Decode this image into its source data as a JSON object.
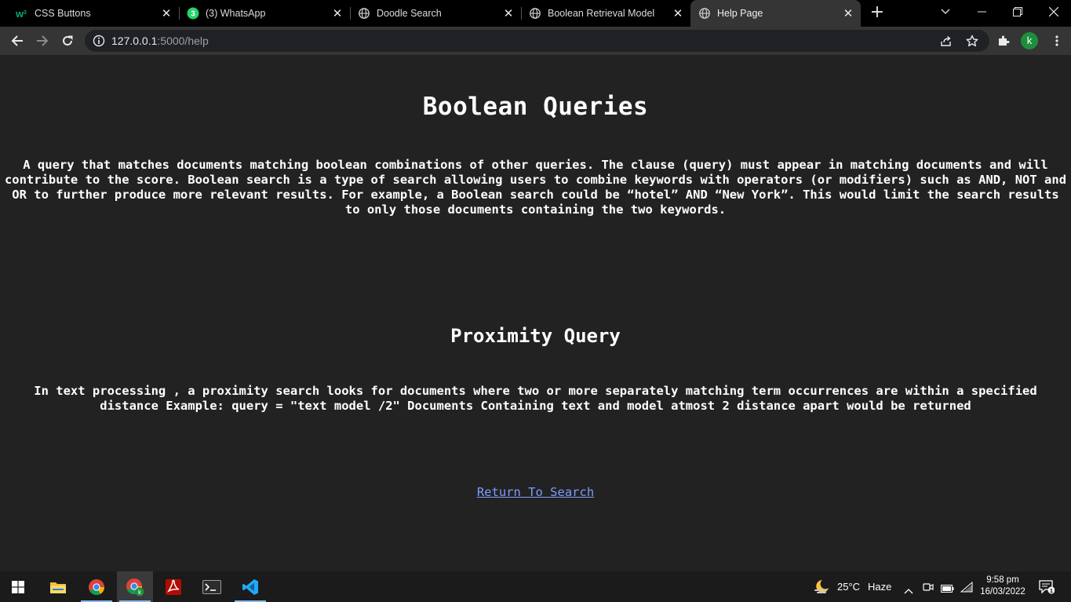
{
  "browser": {
    "tabs": [
      {
        "title": "CSS Buttons",
        "icon": "w3schools-icon"
      },
      {
        "title": "(3) WhatsApp",
        "icon": "whatsapp-icon",
        "badge": "3"
      },
      {
        "title": "Doodle Search",
        "icon": "globe-icon"
      },
      {
        "title": "Boolean Retrieval Model",
        "icon": "globe-icon"
      },
      {
        "title": "Help Page",
        "icon": "globe-icon",
        "active": true
      }
    ],
    "url_host": "127.0.0.1",
    "url_path": ":5000/help",
    "profile_initial": "k"
  },
  "page": {
    "boolean_title": "Boolean Queries",
    "boolean_text": "A query that matches documents matching boolean combinations of other queries. The clause (query) must appear in matching documents and will contribute to the score. Boolean search is a type of search allowing users to combine keywords with operators (or modifiers) such as AND, NOT and OR to further produce more relevant results. For example, a Boolean search could be “hotel” AND “New York”. This would limit the search results to only those documents containing the two keywords.",
    "proximity_title": "Proximity Query",
    "proximity_text": "In text processing , a proximity search looks for documents where two or more separately matching term occurrences are within a specified distance Example: query = \"text model /2\" Documents Containing text and model atmost 2 distance apart would be returned",
    "return_link": "Return To Search"
  },
  "taskbar": {
    "weather_temp": "25°C",
    "weather_cond": "Haze",
    "time": "9:58 pm",
    "date": "16/03/2022",
    "notification_count": "1"
  },
  "colors": {
    "page_bg": "#222222",
    "link": "#7b9cff",
    "tab_active": "#353535"
  }
}
